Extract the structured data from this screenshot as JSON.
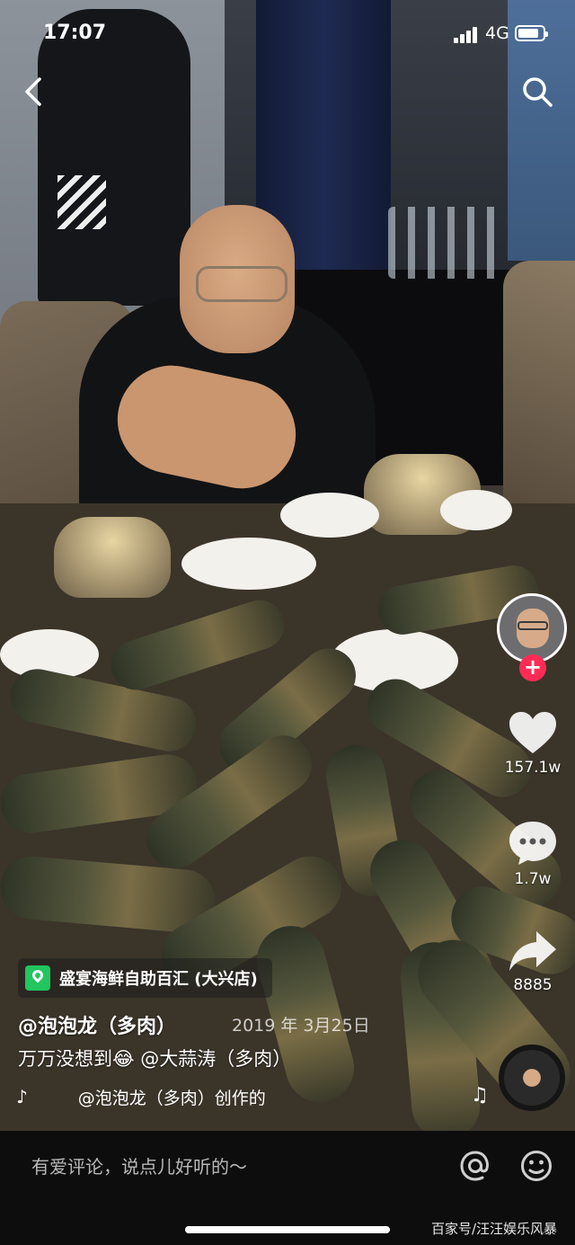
{
  "status_bar": {
    "time": "17:07",
    "network": "4G",
    "battery_level": 0.85
  },
  "video": {
    "location": "盛宴海鲜自助百汇 (大兴店)",
    "author": "@泡泡龙（多肉）",
    "date": "2019 年 3月25日",
    "caption": "万万没想到😂 @大蒜涛（多肉）",
    "music": "@泡泡龙（多肉）创作的"
  },
  "rail": {
    "likes": "157.1w",
    "comments": "1.7w",
    "shares": "8885",
    "follow_label": "+"
  },
  "comment_bar": {
    "placeholder": "有爱评论，说点儿好听的～"
  },
  "watermark": "百家号/汪汪娱乐风暴",
  "colors": {
    "follow": "#fe2c55",
    "poi": "#22c55e"
  }
}
